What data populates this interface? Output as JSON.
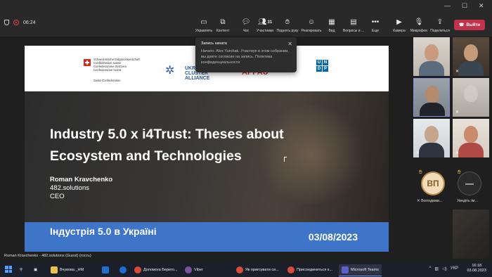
{
  "meeting": {
    "timer": "06:24",
    "leave_label": "Выйти",
    "toolbar": [
      {
        "key": "view",
        "label": "Управлять",
        "icon": "view-icon"
      },
      {
        "key": "content",
        "label": "Контент",
        "icon": "share-content-icon"
      },
      {
        "key": "chat",
        "label": "Чат",
        "icon": "chat-icon"
      },
      {
        "key": "people",
        "label": "Участники",
        "icon": "people-icon",
        "count": "31"
      },
      {
        "key": "raise",
        "label": "Поднять руку",
        "icon": "raise-hand-icon"
      },
      {
        "key": "react",
        "label": "Реагировать",
        "icon": "react-icon"
      },
      {
        "key": "view2",
        "label": "Вид",
        "icon": "grid-view-icon"
      },
      {
        "key": "qa",
        "label": "Вопросы и ...",
        "icon": "qa-icon"
      },
      {
        "key": "more",
        "label": "Еще",
        "icon": "more-icon"
      },
      {
        "key": "camera",
        "label": "Камера",
        "icon": "camera-icon"
      },
      {
        "key": "mic",
        "label": "Микрофон",
        "icon": "mic-off-icon"
      },
      {
        "key": "share",
        "label": "Поделиться",
        "icon": "share-screen-icon"
      }
    ],
    "presenter_strip": "Roman Kravchenko - 482.solutions (Guest) (гость)"
  },
  "toast": {
    "title": "Запись начата",
    "body": "Начато: Alex Yurchak. Участвуя в этом собрании, вы даете согласие на запись. Политика конфиденциальности"
  },
  "slide": {
    "swiss_lines": [
      "Schweizerische Eidgenossenschaft",
      "Confédération suisse",
      "Confederazione Svizzera",
      "Confederaziun svizra"
    ],
    "swiss_sub": "Swiss Confederation",
    "ukr_cluster": "UKRAINIAN CLUSTER ALLIANCE",
    "appau": "APPAU",
    "undp": [
      "U",
      "N",
      "D",
      "P"
    ],
    "title": "Industry 5.0 x i4Trust: Theses about Ecosystem and Technologies",
    "speaker_name": "Roman Kravchenko",
    "speaker_org": "482.solutions",
    "speaker_role": "CEO",
    "band_title": "Індустрія 5.0 в Україні",
    "date": "03/08/2023"
  },
  "participants": {
    "avatar1_initials": "ВП",
    "avatar1_label": "Володими...",
    "avatar2_label": "Уведіть ім..."
  },
  "taskbar": {
    "apps": [
      {
        "label": "Вчувова _НМ",
        "color": "#e8c24a"
      },
      {
        "label": "",
        "color": "#1f6fd0"
      },
      {
        "label": "Допомога Берего...",
        "color": "#d94b3b"
      },
      {
        "label": "Viber",
        "color": "#7b519d"
      },
      {
        "label": "Як пригсувати си...",
        "color": "#d94b3b"
      },
      {
        "label": "Присоединиться к...",
        "color": "#d94b3b"
      },
      {
        "label": "Microsoft Teams",
        "color": "#5b5fc7"
      }
    ],
    "lang": "УКР",
    "time": "16:18",
    "date": "03.08.2023"
  },
  "colors": {
    "leave": "#c4314b",
    "band": "#3f75c8",
    "teams": "#5b5fc7"
  }
}
